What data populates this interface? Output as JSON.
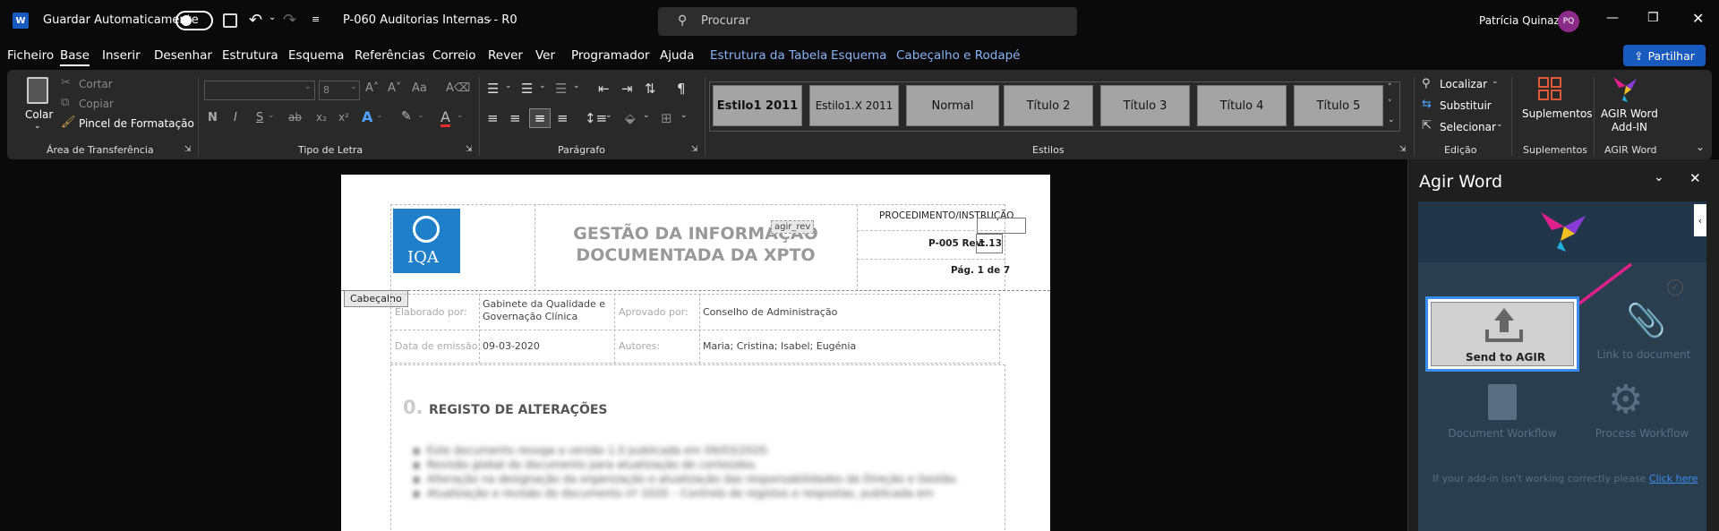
{
  "app": {
    "autosave_label": "Guardar Automaticamente",
    "document_title": "P-060 Auditorias Internas - R0",
    "search_placeholder": "Procurar",
    "user_name": "Patrícia Quinaz",
    "user_initials": "PQ",
    "brand_color": "#185abd",
    "avatar_color": "#8a2b88"
  },
  "menu": {
    "items": [
      "Ficheiro",
      "Base",
      "Inserir",
      "Desenhar",
      "Estrutura",
      "Esquema",
      "Referências",
      "Correio",
      "Rever",
      "Ver",
      "Programador",
      "Ajuda",
      "Estrutura da Tabela",
      "Esquema",
      "Cabeçalho e Rodapé"
    ],
    "active": "Base",
    "share_label": "Partilhar"
  },
  "ribbon": {
    "clipboard": {
      "paste": "Colar",
      "cut": "Cortar",
      "copy": "Copiar",
      "format_painter": "Pincel de Formatação",
      "label": "Área de Transferência"
    },
    "font": {
      "size": "8",
      "label": "Tipo de Letra",
      "bold": "N",
      "italic": "I",
      "underline": "S"
    },
    "paragraph": {
      "label": "Parágrafo"
    },
    "styles": {
      "items": [
        "Estilo1 2011",
        "Estilo1.X 2011",
        "Normal",
        "Título 2",
        "Título 3",
        "Título 4",
        "Título 5"
      ],
      "label": "Estilos"
    },
    "editing": {
      "find": "Localizar",
      "replace": "Substituir",
      "select": "Selecionar",
      "label": "Edição"
    },
    "addins": {
      "label": "Suplementos",
      "button": "Suplementos"
    },
    "agir": {
      "button_line1": "AGIR Word",
      "button_line2": "Add-IN",
      "label": "AGIR Word"
    }
  },
  "document": {
    "logo_text": "IQA",
    "title_line1": "GESTÃO DA INFORMAÇÃO",
    "title_line2": "DOCUMENTADA DA XPTO",
    "field_tag": "agir_rev",
    "proc_label": "PROCEDIMENTO/INSTRUÇÃO",
    "code": "P-005 Rev:",
    "rev": "1.13",
    "page": "Pág. 1 de 7",
    "header_tag": "Cabeçalho",
    "made_by_label": "Elaborado por:",
    "made_by": "Gabinete da Qualidade e Governação Clínica",
    "approved_label": "Aprovado por:",
    "approved": "Conselho de Administração",
    "date_label": "Data de emissão:",
    "date": "09-03-2020",
    "authors_label": "Autores:",
    "authors": "Maria; Cristina; Isabel; Eugénia",
    "section_num": "0.",
    "section_title": "REGISTO DE ALTERAÇÕES",
    "blurred_lines": [
      "Este documento revoga a versão 1.0 publicada em 09/03/2020.",
      "Revisão global do documento para atualização de conteúdos.",
      "Alteração na designação da organização e atualização das responsabilidades da Direção e Gestão.",
      "Atualização e revisão do documento nº 1020 – Controlo de registos e respostas, publicada em"
    ]
  },
  "pane": {
    "title": "Agir Word",
    "send_label": "Send to AGIR",
    "link_label": "Link to document",
    "doc_workflow_label": "Document Workflow",
    "process_workflow_label": "Process Workflow",
    "footer_text": "If your add-in isn't working correctly please",
    "footer_link": "Click here"
  }
}
